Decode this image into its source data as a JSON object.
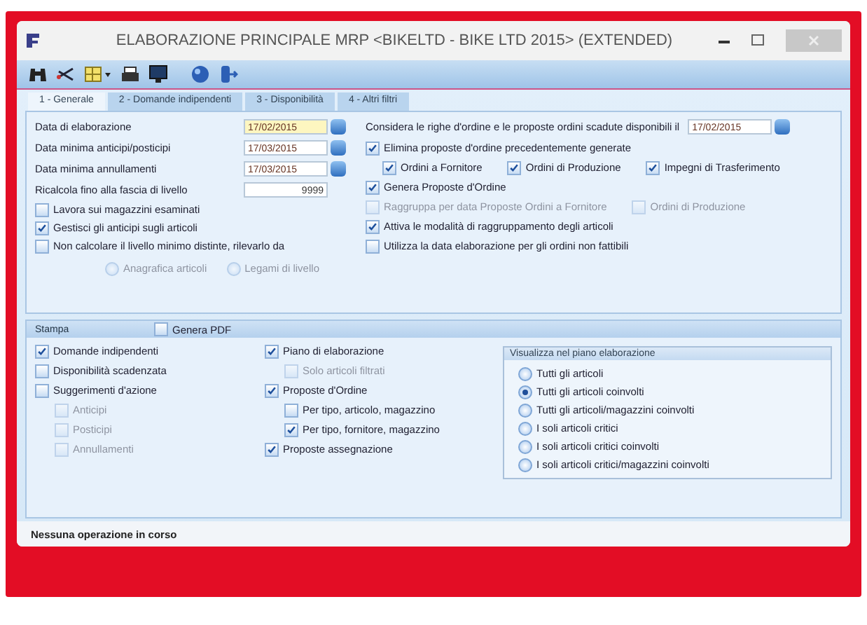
{
  "window": {
    "title": "ELABORAZIONE PRINCIPALE MRP <BIKELTD - BIKE LTD 2015> (EXTENDED)"
  },
  "tabs": [
    {
      "label": "1 - Generale",
      "selected": true
    },
    {
      "label": "2 - Domande indipendenti",
      "selected": false
    },
    {
      "label": "3 - Disponibilità",
      "selected": false
    },
    {
      "label": "4 - Altri filtri",
      "selected": false
    }
  ],
  "general": {
    "fields": [
      {
        "label": "Data di elaborazione",
        "value": "17/02/2015",
        "kind": "date",
        "focused": true
      },
      {
        "label": "Data minima anticipi/posticipi",
        "value": "17/03/2015",
        "kind": "date",
        "focused": false
      },
      {
        "label": "Data minima annullamenti",
        "value": "17/03/2015",
        "kind": "date",
        "focused": false
      },
      {
        "label": "Ricalcola fino alla fascia di livello",
        "value": "9999",
        "kind": "number",
        "focused": false
      }
    ],
    "options": [
      {
        "label": "Lavora sui magazzini esaminati",
        "checked": false,
        "disabled": false
      },
      {
        "label": "Gestisci gli anticipi sugli articoli",
        "checked": true,
        "disabled": false
      },
      {
        "label": "Non calcolare il livello minimo distinte, rilevarlo da",
        "checked": false,
        "disabled": false
      }
    ],
    "level_source": [
      {
        "label": "Anagrafica articoli",
        "selected": false,
        "disabled": true
      },
      {
        "label": "Legami di livello",
        "selected": false,
        "disabled": true
      }
    ],
    "due_orders": {
      "label": "Considera le righe d'ordine e le proposte ordini scadute disponibili il",
      "value": "17/02/2015"
    },
    "rows": [
      {
        "items": [
          {
            "label": "Elimina proposte d'ordine precedentemente generate",
            "checked": true,
            "disabled": false
          }
        ],
        "children": [
          {
            "items": [
              {
                "label": "Ordini a Fornitore",
                "checked": true,
                "disabled": false
              },
              {
                "label": "Ordini di Produzione",
                "checked": true,
                "disabled": false
              },
              {
                "label": "Impegni di Trasferimento",
                "checked": true,
                "disabled": false
              }
            ]
          }
        ]
      },
      {
        "items": [
          {
            "label": "Genera Proposte d'Ordine",
            "checked": true,
            "disabled": false
          }
        ]
      },
      {
        "items": [
          {
            "label": "Raggruppa per data Proposte Ordini a Fornitore",
            "checked": false,
            "disabled": true
          },
          {
            "label": "Ordini di Produzione",
            "checked": false,
            "disabled": true
          }
        ]
      },
      {
        "items": [
          {
            "label": "Attiva le modalità di raggruppamento degli articoli",
            "checked": true,
            "disabled": false
          }
        ]
      },
      {
        "items": [
          {
            "label": "Utilizza la data elaborazione per gli ordini non fattibili",
            "checked": false,
            "disabled": false
          }
        ]
      }
    ]
  },
  "print": {
    "title": "Stampa",
    "pdf": {
      "label": "Genera PDF",
      "checked": false
    },
    "columns": [
      [
        {
          "label": "Domande indipendenti",
          "checked": true,
          "disabled": false
        },
        {
          "label": "Disponibilità scadenzata",
          "checked": false,
          "disabled": false
        },
        {
          "label": "Suggerimenti d'azione",
          "checked": false,
          "disabled": false,
          "children": [
            {
              "label": "Anticipi",
              "checked": false,
              "disabled": true
            },
            {
              "label": "Posticipi",
              "checked": false,
              "disabled": true
            },
            {
              "label": "Annullamenti",
              "checked": false,
              "disabled": true
            }
          ]
        }
      ],
      [
        {
          "label": "Piano di elaborazione",
          "checked": true,
          "disabled": false,
          "children": [
            {
              "label": "Solo articoli filtrati",
              "checked": false,
              "disabled": true
            }
          ]
        },
        {
          "label": "Proposte d'Ordine",
          "checked": true,
          "disabled": false,
          "children": [
            {
              "label": "Per tipo, articolo, magazzino",
              "checked": false,
              "disabled": false
            },
            {
              "label": "Per tipo, fornitore, magazzino",
              "checked": true,
              "disabled": false
            }
          ]
        },
        {
          "label": "Proposte assegnazione",
          "checked": true,
          "disabled": false
        }
      ]
    ],
    "view": {
      "title": "Visualizza nel piano elaborazione",
      "options": [
        {
          "label": "Tutti gli articoli",
          "selected": false
        },
        {
          "label": "Tutti gli articoli coinvolti",
          "selected": true
        },
        {
          "label": "Tutti gli articoli/magazzini coinvolti",
          "selected": false
        },
        {
          "label": "I soli articoli critici",
          "selected": false
        },
        {
          "label": "I soli articoli critici coinvolti",
          "selected": false
        },
        {
          "label": "I soli articoli critici/magazzini coinvolti",
          "selected": false
        }
      ]
    }
  },
  "status_bar": {
    "text": "Nessuna operazione in corso"
  }
}
